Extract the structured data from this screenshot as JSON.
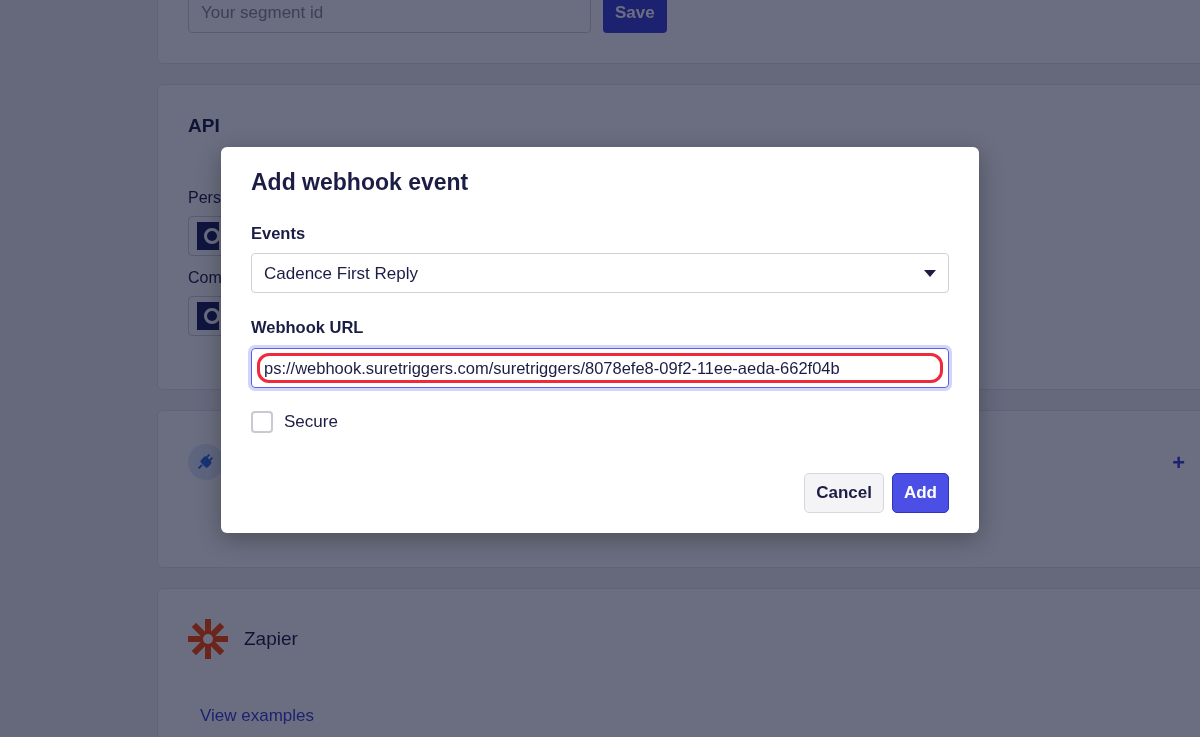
{
  "background": {
    "segment": {
      "placeholder": "Your segment id",
      "button": "Save"
    },
    "api": {
      "title": "API",
      "fields": [
        {
          "label": "Pers"
        },
        {
          "label": "Com"
        }
      ]
    },
    "integration": {
      "action": "+"
    },
    "zapier": {
      "title": "Zapier",
      "link": "View examples"
    }
  },
  "modal": {
    "title": "Add webhook event",
    "events_label": "Events",
    "event": "Cadence First Reply",
    "url_label": "Webhook URL",
    "url": "ps://webhook.suretriggers.com/suretriggers/8078efe8-09f2-11ee-aeda-662f04b",
    "secure": {
      "label": "Secure",
      "checked": false
    },
    "buttons": [
      {
        "label": "Cancel",
        "kind": "secondary"
      },
      {
        "label": "Add",
        "kind": "primary"
      }
    ]
  }
}
